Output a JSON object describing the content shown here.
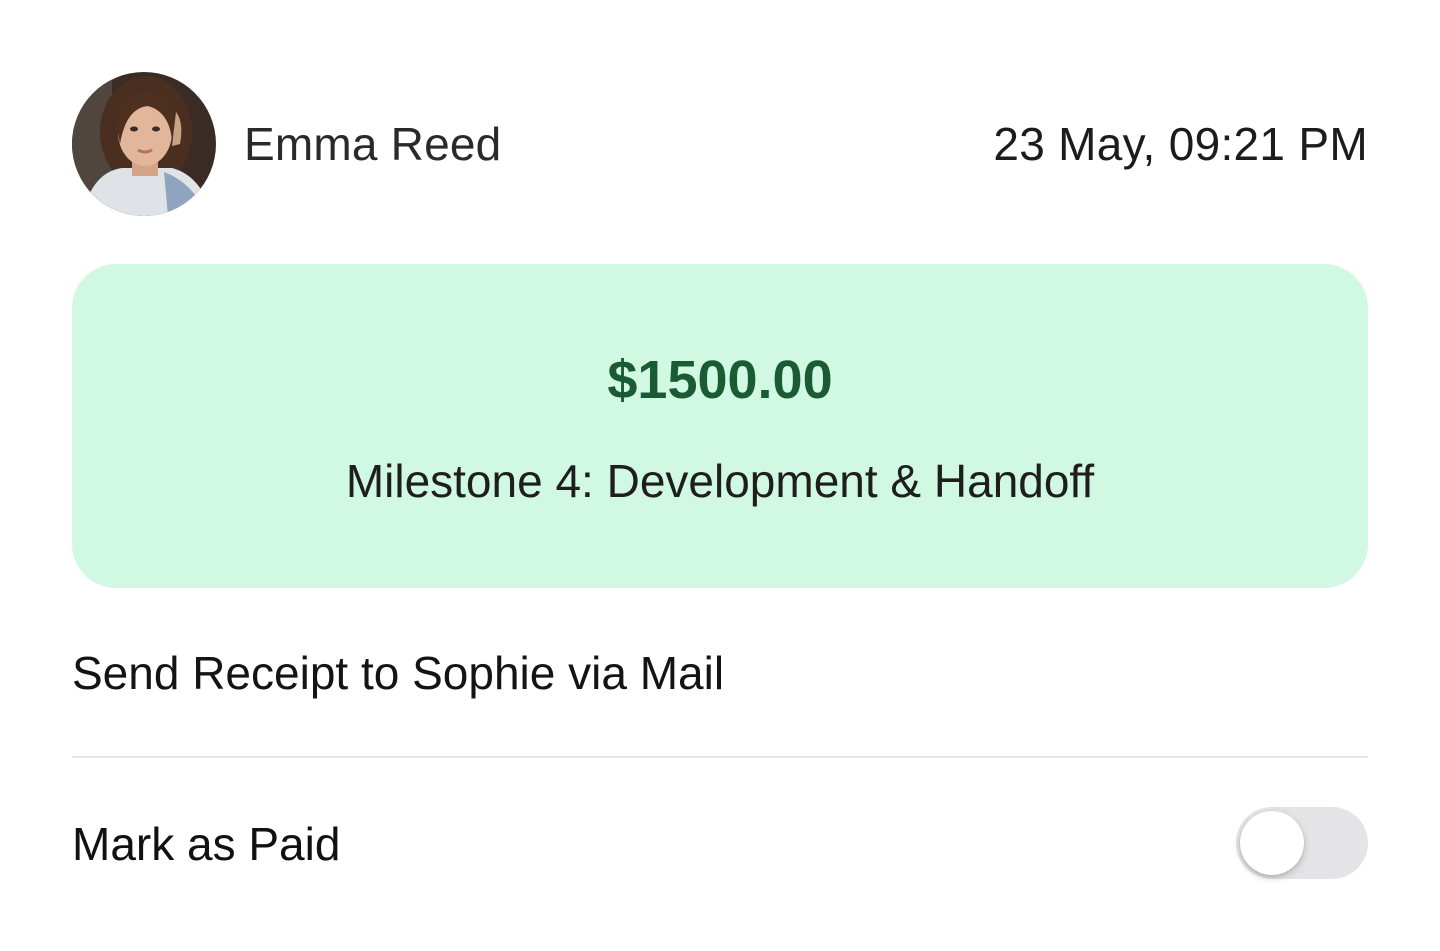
{
  "header": {
    "user_name": "Emma Reed",
    "timestamp": "23 May, 09:21 PM"
  },
  "payment": {
    "amount": "$1500.00",
    "description": "Milestone 4: Development & Handoff"
  },
  "actions": {
    "send_receipt_label": "Send Receipt to Sophie via Mail",
    "mark_paid_label": "Mark as Paid",
    "mark_paid_on": false
  },
  "colors": {
    "panel_background": "#d1f8e2",
    "amount_text": "#1b5b34",
    "toggle_off": "#e4e4e6",
    "divider": "#e4e4e4"
  }
}
